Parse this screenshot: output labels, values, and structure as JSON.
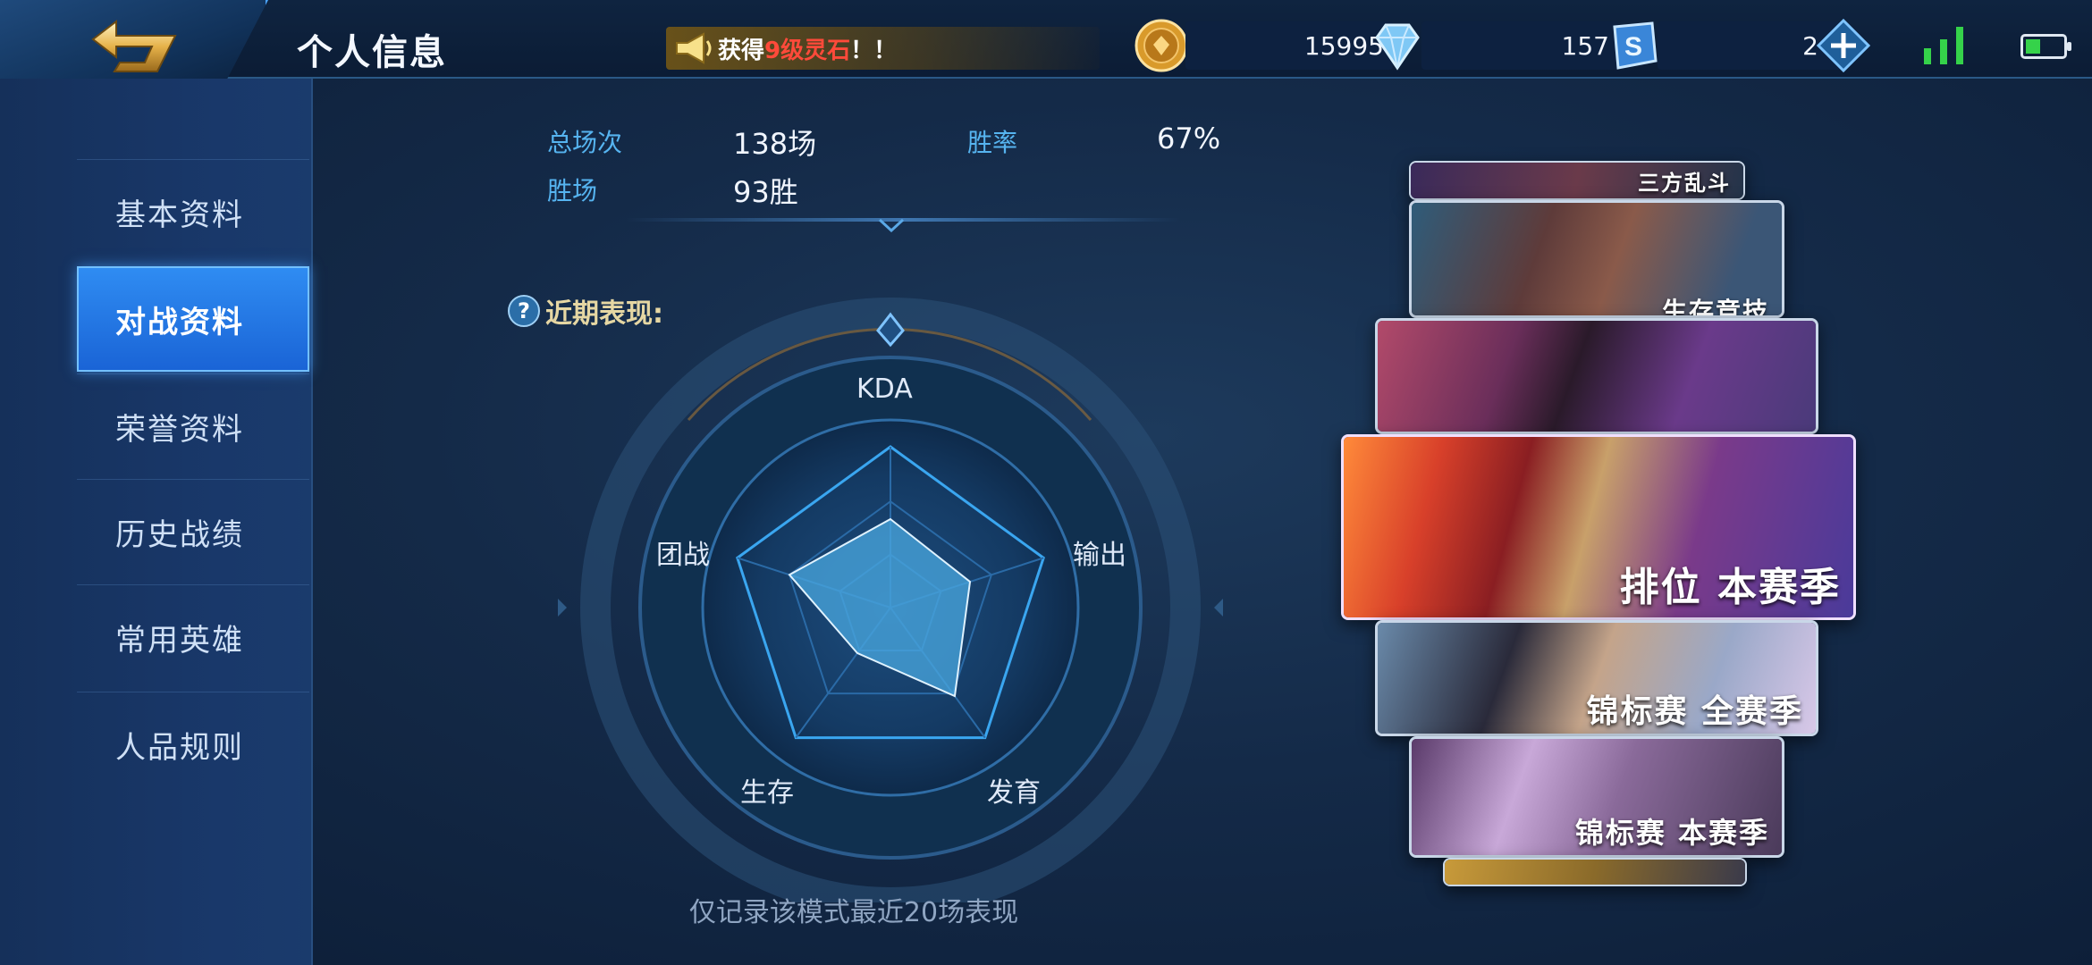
{
  "header": {
    "title": "个人信息",
    "notice": {
      "before": "获得",
      "highlight": "9级灵石",
      "after": "！！"
    },
    "currencies": [
      {
        "name": "gold-coin",
        "value": "15995"
      },
      {
        "name": "diamond",
        "value": "157"
      },
      {
        "name": "s-coupon",
        "value": "2"
      }
    ]
  },
  "sidebar": {
    "items": [
      {
        "label": "基本资料",
        "active": false
      },
      {
        "label": "对战资料",
        "active": true
      },
      {
        "label": "荣誉资料",
        "active": false
      },
      {
        "label": "历史战绩",
        "active": false
      },
      {
        "label": "常用英雄",
        "active": false
      },
      {
        "label": "人品规则",
        "active": false
      }
    ]
  },
  "stats": {
    "total_label": "总场次",
    "total_value": "138场",
    "winrate_label": "胜率",
    "winrate_value": "67%",
    "wins_label": "胜场",
    "wins_value": "93胜"
  },
  "recent": {
    "label": "近期表现:",
    "radar_axes": [
      "KDA",
      "输出",
      "发育",
      "生存",
      "团战"
    ],
    "radar_values": [
      0.55,
      0.52,
      0.68,
      0.35,
      0.66
    ],
    "footnote": "仅记录该模式最近20场表现"
  },
  "modes": {
    "cards": [
      {
        "label": "三方乱斗"
      },
      {
        "label": "生存竞技"
      },
      {
        "label": ""
      },
      {
        "label": "排位 本赛季"
      },
      {
        "label": "锦标赛 全赛季"
      },
      {
        "label": "锦标赛 本赛季"
      },
      {
        "label": ""
      }
    ]
  },
  "colors": {
    "accent": "#2f8cf2",
    "radar_fill": "#4aa8e0",
    "label_blue": "#56b4f0",
    "highlight_red": "#ff4a3a"
  }
}
